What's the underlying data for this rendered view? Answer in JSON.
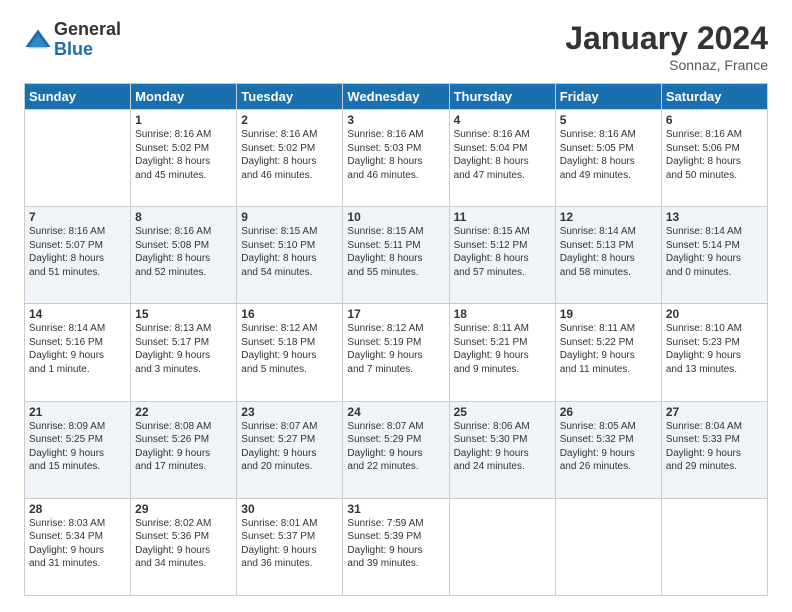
{
  "logo": {
    "general": "General",
    "blue": "Blue"
  },
  "header": {
    "month": "January 2024",
    "location": "Sonnaz, France"
  },
  "weekdays": [
    "Sunday",
    "Monday",
    "Tuesday",
    "Wednesday",
    "Thursday",
    "Friday",
    "Saturday"
  ],
  "weeks": [
    [
      {
        "day": "",
        "info": ""
      },
      {
        "day": "1",
        "info": "Sunrise: 8:16 AM\nSunset: 5:02 PM\nDaylight: 8 hours\nand 45 minutes."
      },
      {
        "day": "2",
        "info": "Sunrise: 8:16 AM\nSunset: 5:02 PM\nDaylight: 8 hours\nand 46 minutes."
      },
      {
        "day": "3",
        "info": "Sunrise: 8:16 AM\nSunset: 5:03 PM\nDaylight: 8 hours\nand 46 minutes."
      },
      {
        "day": "4",
        "info": "Sunrise: 8:16 AM\nSunset: 5:04 PM\nDaylight: 8 hours\nand 47 minutes."
      },
      {
        "day": "5",
        "info": "Sunrise: 8:16 AM\nSunset: 5:05 PM\nDaylight: 8 hours\nand 49 minutes."
      },
      {
        "day": "6",
        "info": "Sunrise: 8:16 AM\nSunset: 5:06 PM\nDaylight: 8 hours\nand 50 minutes."
      }
    ],
    [
      {
        "day": "7",
        "info": "Sunrise: 8:16 AM\nSunset: 5:07 PM\nDaylight: 8 hours\nand 51 minutes."
      },
      {
        "day": "8",
        "info": "Sunrise: 8:16 AM\nSunset: 5:08 PM\nDaylight: 8 hours\nand 52 minutes."
      },
      {
        "day": "9",
        "info": "Sunrise: 8:15 AM\nSunset: 5:10 PM\nDaylight: 8 hours\nand 54 minutes."
      },
      {
        "day": "10",
        "info": "Sunrise: 8:15 AM\nSunset: 5:11 PM\nDaylight: 8 hours\nand 55 minutes."
      },
      {
        "day": "11",
        "info": "Sunrise: 8:15 AM\nSunset: 5:12 PM\nDaylight: 8 hours\nand 57 minutes."
      },
      {
        "day": "12",
        "info": "Sunrise: 8:14 AM\nSunset: 5:13 PM\nDaylight: 8 hours\nand 58 minutes."
      },
      {
        "day": "13",
        "info": "Sunrise: 8:14 AM\nSunset: 5:14 PM\nDaylight: 9 hours\nand 0 minutes."
      }
    ],
    [
      {
        "day": "14",
        "info": "Sunrise: 8:14 AM\nSunset: 5:16 PM\nDaylight: 9 hours\nand 1 minute."
      },
      {
        "day": "15",
        "info": "Sunrise: 8:13 AM\nSunset: 5:17 PM\nDaylight: 9 hours\nand 3 minutes."
      },
      {
        "day": "16",
        "info": "Sunrise: 8:12 AM\nSunset: 5:18 PM\nDaylight: 9 hours\nand 5 minutes."
      },
      {
        "day": "17",
        "info": "Sunrise: 8:12 AM\nSunset: 5:19 PM\nDaylight: 9 hours\nand 7 minutes."
      },
      {
        "day": "18",
        "info": "Sunrise: 8:11 AM\nSunset: 5:21 PM\nDaylight: 9 hours\nand 9 minutes."
      },
      {
        "day": "19",
        "info": "Sunrise: 8:11 AM\nSunset: 5:22 PM\nDaylight: 9 hours\nand 11 minutes."
      },
      {
        "day": "20",
        "info": "Sunrise: 8:10 AM\nSunset: 5:23 PM\nDaylight: 9 hours\nand 13 minutes."
      }
    ],
    [
      {
        "day": "21",
        "info": "Sunrise: 8:09 AM\nSunset: 5:25 PM\nDaylight: 9 hours\nand 15 minutes."
      },
      {
        "day": "22",
        "info": "Sunrise: 8:08 AM\nSunset: 5:26 PM\nDaylight: 9 hours\nand 17 minutes."
      },
      {
        "day": "23",
        "info": "Sunrise: 8:07 AM\nSunset: 5:27 PM\nDaylight: 9 hours\nand 20 minutes."
      },
      {
        "day": "24",
        "info": "Sunrise: 8:07 AM\nSunset: 5:29 PM\nDaylight: 9 hours\nand 22 minutes."
      },
      {
        "day": "25",
        "info": "Sunrise: 8:06 AM\nSunset: 5:30 PM\nDaylight: 9 hours\nand 24 minutes."
      },
      {
        "day": "26",
        "info": "Sunrise: 8:05 AM\nSunset: 5:32 PM\nDaylight: 9 hours\nand 26 minutes."
      },
      {
        "day": "27",
        "info": "Sunrise: 8:04 AM\nSunset: 5:33 PM\nDaylight: 9 hours\nand 29 minutes."
      }
    ],
    [
      {
        "day": "28",
        "info": "Sunrise: 8:03 AM\nSunset: 5:34 PM\nDaylight: 9 hours\nand 31 minutes."
      },
      {
        "day": "29",
        "info": "Sunrise: 8:02 AM\nSunset: 5:36 PM\nDaylight: 9 hours\nand 34 minutes."
      },
      {
        "day": "30",
        "info": "Sunrise: 8:01 AM\nSunset: 5:37 PM\nDaylight: 9 hours\nand 36 minutes."
      },
      {
        "day": "31",
        "info": "Sunrise: 7:59 AM\nSunset: 5:39 PM\nDaylight: 9 hours\nand 39 minutes."
      },
      {
        "day": "",
        "info": ""
      },
      {
        "day": "",
        "info": ""
      },
      {
        "day": "",
        "info": ""
      }
    ]
  ]
}
